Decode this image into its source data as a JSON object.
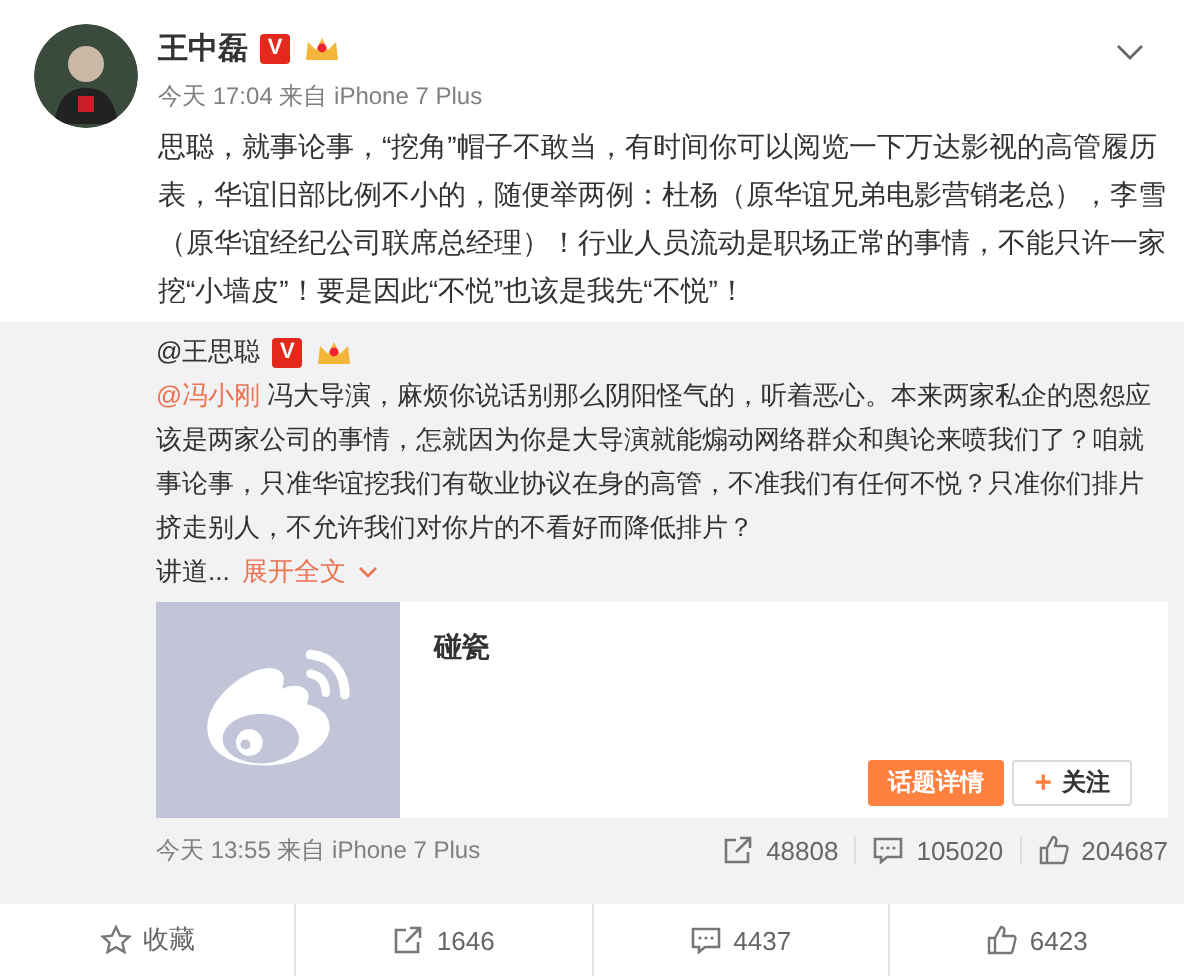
{
  "post": {
    "author": "王中磊",
    "verified_badge": "V",
    "meta": "今天 17:04 来自 iPhone 7 Plus",
    "text": "思聪，就事论事，“挖角”帽子不敢当，有时间你可以阅览一下万达影视的高管履历表，华谊旧部比例不小的，随便举两例：杜杨（原华谊兄弟电影营销老总），李雪（原华谊经纪公司联席总经理）！行业人员流动是职场正常的事情，不能只许一家挖“小墙皮”！要是因此“不悦”也该是我先“不悦”！"
  },
  "repost": {
    "author": "@王思聪",
    "verified_badge": "V",
    "mention": "@冯小刚",
    "text": " 冯大导演，麻烦你说话别那么阴阳怪气的，听着恶心。本来两家私企的恩怨应该是两家公司的事情，怎就因为你是大导演就能煽动网络群众和舆论来喷我们了？咱就事论事，只准华谊挖我们有敬业协议在身的高管，不准我们有任何不悦？只准你们排片挤走别人，不允许我们对你片的不看好而降低排片？",
    "tail": "讲道...",
    "expand_link": "展开全文",
    "card": {
      "title": "碰瓷",
      "primary_button": "话题详情",
      "follow_icon": "+",
      "follow_button": "关注"
    },
    "meta": "今天 13:55 来自 iPhone 7 Plus",
    "stats": [
      {
        "kind": "repost",
        "count": "48808"
      },
      {
        "kind": "comment",
        "count": "105020"
      },
      {
        "kind": "like",
        "count": "204687"
      }
    ]
  },
  "actions": [
    {
      "kind": "favorite",
      "label": "收藏"
    },
    {
      "kind": "repost",
      "label": "1646"
    },
    {
      "kind": "comment",
      "label": "4437"
    },
    {
      "kind": "like",
      "label": "6423"
    }
  ]
}
